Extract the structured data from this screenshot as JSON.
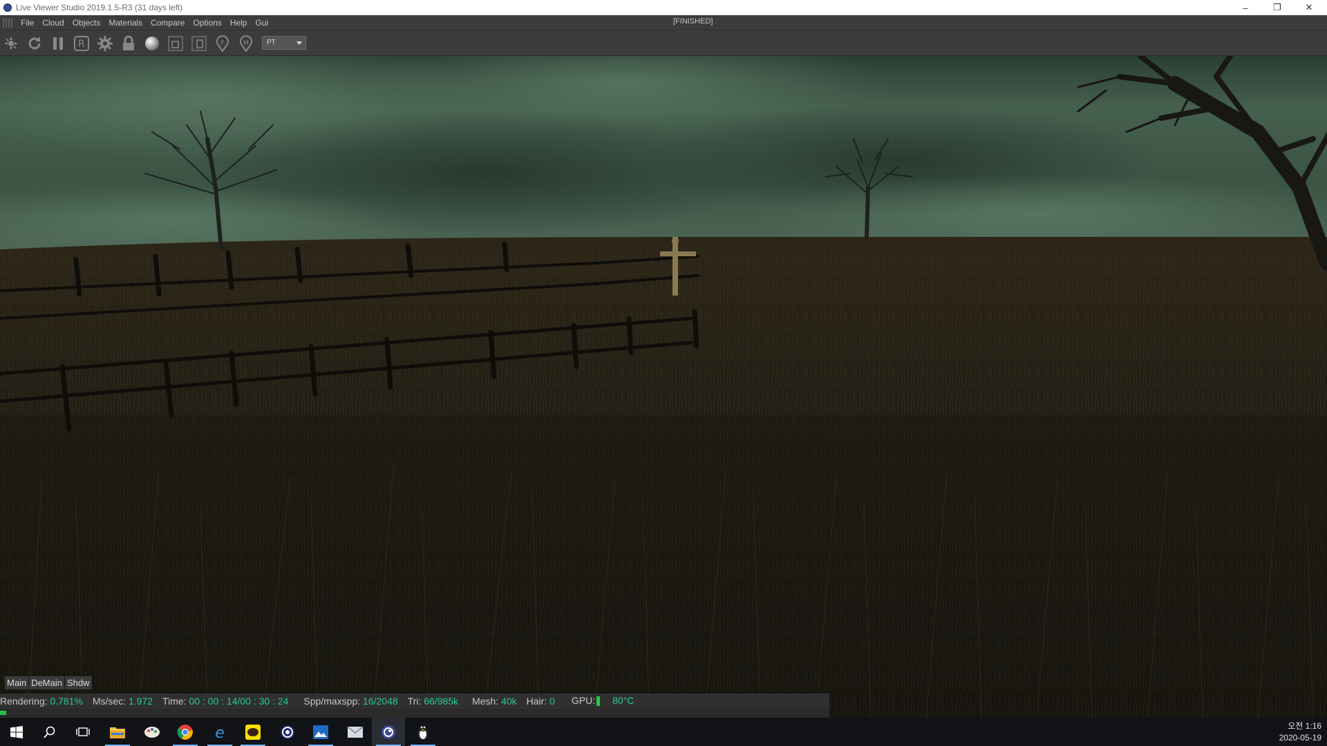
{
  "window": {
    "title": "Live Viewer Studio 2019.1.5-R3 (31 days left)",
    "controls": [
      "minimize-icon",
      "restore-icon",
      "close-icon"
    ]
  },
  "menu": {
    "items": [
      "File",
      "Cloud",
      "Objects",
      "Materials",
      "Compare",
      "Options",
      "Help",
      "Gui"
    ],
    "status": "[FINISHED]"
  },
  "toolbar": {
    "icons": [
      "recompile-icon",
      "reset-icon",
      "pause-icon",
      "render-region-icon",
      "settings-gear-icon",
      "lock-icon",
      "sphere-icon",
      "region-select-icon",
      "film-region-icon",
      "pin-f-icon",
      "pin-m-icon"
    ],
    "kernel_select": "PT"
  },
  "subtabs": [
    "Main",
    "DeMain",
    "Shdw"
  ],
  "status": {
    "rendering_label": "Rendering:",
    "rendering_value": "0.781%",
    "mssec_label": "Ms/sec:",
    "mssec_value": "1.972",
    "time_label": "Time:",
    "time_value": "00 : 00 : 14/00 : 30 : 24",
    "spp_label": "Spp/maxspp:",
    "spp_value": "16/2048",
    "tri_label": "Tri:",
    "tri_value": "66/985k",
    "mesh_label": "Mesh:",
    "mesh_value": "40k",
    "hair_label": "Hair:",
    "hair_value": "0",
    "gpu_label": "GPU:",
    "gpu_temp": "80°C",
    "progress_fraction": 0.00781
  },
  "taskbar": {
    "apps": [
      "start-icon",
      "search-icon",
      "task-view-icon",
      "file-explorer-icon",
      "paint-app-icon",
      "chrome-icon",
      "edge-icon",
      "kakaotalk-icon",
      "cinema4d-icon",
      "photos-icon",
      "mail-icon",
      "live-viewer-icon",
      "tux-icon"
    ],
    "time": "오전 1:16",
    "date": "2020-05-19"
  },
  "colors": {
    "menu_bg": "#3c3c3c",
    "status_value": "#2bc79a",
    "gpu_bar": "#1ecb4a",
    "progress": "#2ac24a",
    "taskbar_bg": "#111317"
  }
}
